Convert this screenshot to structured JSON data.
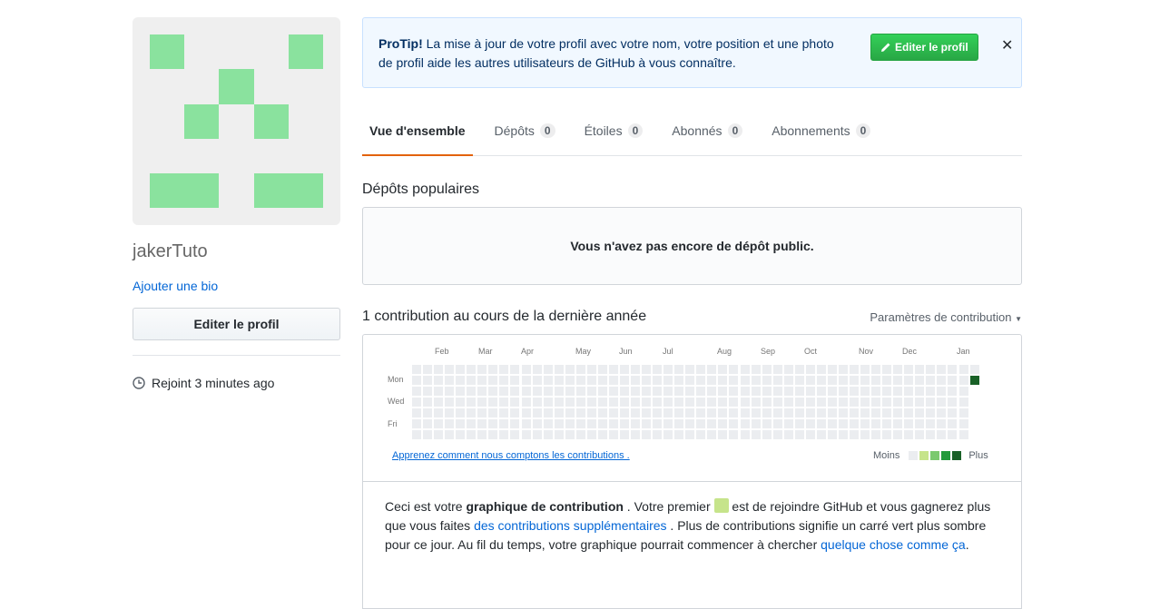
{
  "profile": {
    "username": "jakerTuto",
    "add_bio": "Ajouter une bio",
    "edit_button": "Editer le profil",
    "joined": "Rejoint 3 minutes ago",
    "avatar_color": "#8ae29e"
  },
  "protip": {
    "label": "ProTip!",
    "text": " La mise à jour de votre profil avec votre nom, votre position et une photo de profil aide les autres utilisateurs de GitHub à vous connaître.",
    "button": "Editer le profil",
    "close": "✕"
  },
  "tabs": [
    {
      "label": "Vue d'ensemble",
      "count": "",
      "active": true
    },
    {
      "label": "Dépôts",
      "count": "0"
    },
    {
      "label": "Étoiles",
      "count": "0"
    },
    {
      "label": "Abonnés",
      "count": "0"
    },
    {
      "label": "Abonnements",
      "count": "0"
    }
  ],
  "popular": {
    "title": "Dépôts populaires",
    "empty": "Vous n'avez pas encore de dépôt public."
  },
  "contrib": {
    "title": "1 contribution au cours de la dernière année",
    "settings": "Paramètres de contribution",
    "months": [
      "Feb",
      "Mar",
      "Apr",
      "May",
      "Jun",
      "Jul",
      "Aug",
      "Sep",
      "Oct",
      "Nov",
      "Dec",
      "Jan"
    ],
    "days": [
      "Mon",
      "Wed",
      "Fri"
    ],
    "learn": "Apprenez comment nous comptons les contributions .",
    "legend_less": "Moins",
    "legend_more": "Plus",
    "legend_colors": [
      "#ebedf0",
      "#c6e48b",
      "#7bc96f",
      "#239a3b",
      "#196127"
    ],
    "empty_color": "#ebedf0",
    "active_color": "#196127",
    "info_1": "Ceci est votre ",
    "info_bold": "graphique de contribution",
    "info_2": " . Votre premier ",
    "info_3": " est de rejoindre GitHub et vous gagnerez plus que vous faites ",
    "info_link1": "des contributions supplémentaires",
    "info_4": " . Plus de contributions signifie un carré vert plus sombre pour ce jour. Au fil du temps, votre graphique pourrait commencer à chercher ",
    "info_link2": "quelque chose comme ça",
    "info_5": "."
  }
}
